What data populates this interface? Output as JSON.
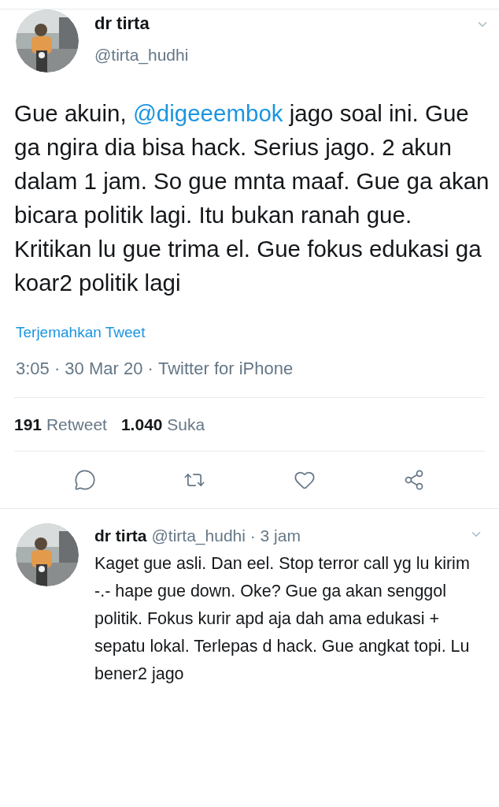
{
  "tweet": {
    "name": "dr tirta",
    "handle": "@tirta_hudhi",
    "body": [
      {
        "kind": "text",
        "text": "Gue akuin, "
      },
      {
        "kind": "mention",
        "text": "@digeeembok"
      },
      {
        "kind": "text",
        "text": " jago soal ini. Gue ga ngira dia bisa hack. Serius jago. 2 akun dalam 1 jam. So gue mnta maaf. Gue ga akan bicara politik lagi. Itu bukan ranah gue. Kritikan lu gue trima el. Gue fokus edukasi ga koar2 politik lagi"
      }
    ],
    "translate": "Terjemahkan Tweet",
    "meta": "3:05 · 30 Mar 20 · ",
    "source": "Twitter for iPhone",
    "stats": [
      {
        "count": "191",
        "label": "Retweet"
      },
      {
        "count": "1.040",
        "label": "Suka"
      }
    ]
  },
  "reply": {
    "name": "dr tirta",
    "handle": "@tirta_hudhi · 3 jam",
    "text": "Kaget gue asli. Dan eel. Stop terror call yg lu kirim -.- hape gue down. Oke? Gue ga akan senggol politik. Fokus kurir apd aja dah ama edukasi + sepatu lokal. Terlepas d hack. Gue angkat topi. Lu bener2 jago"
  }
}
